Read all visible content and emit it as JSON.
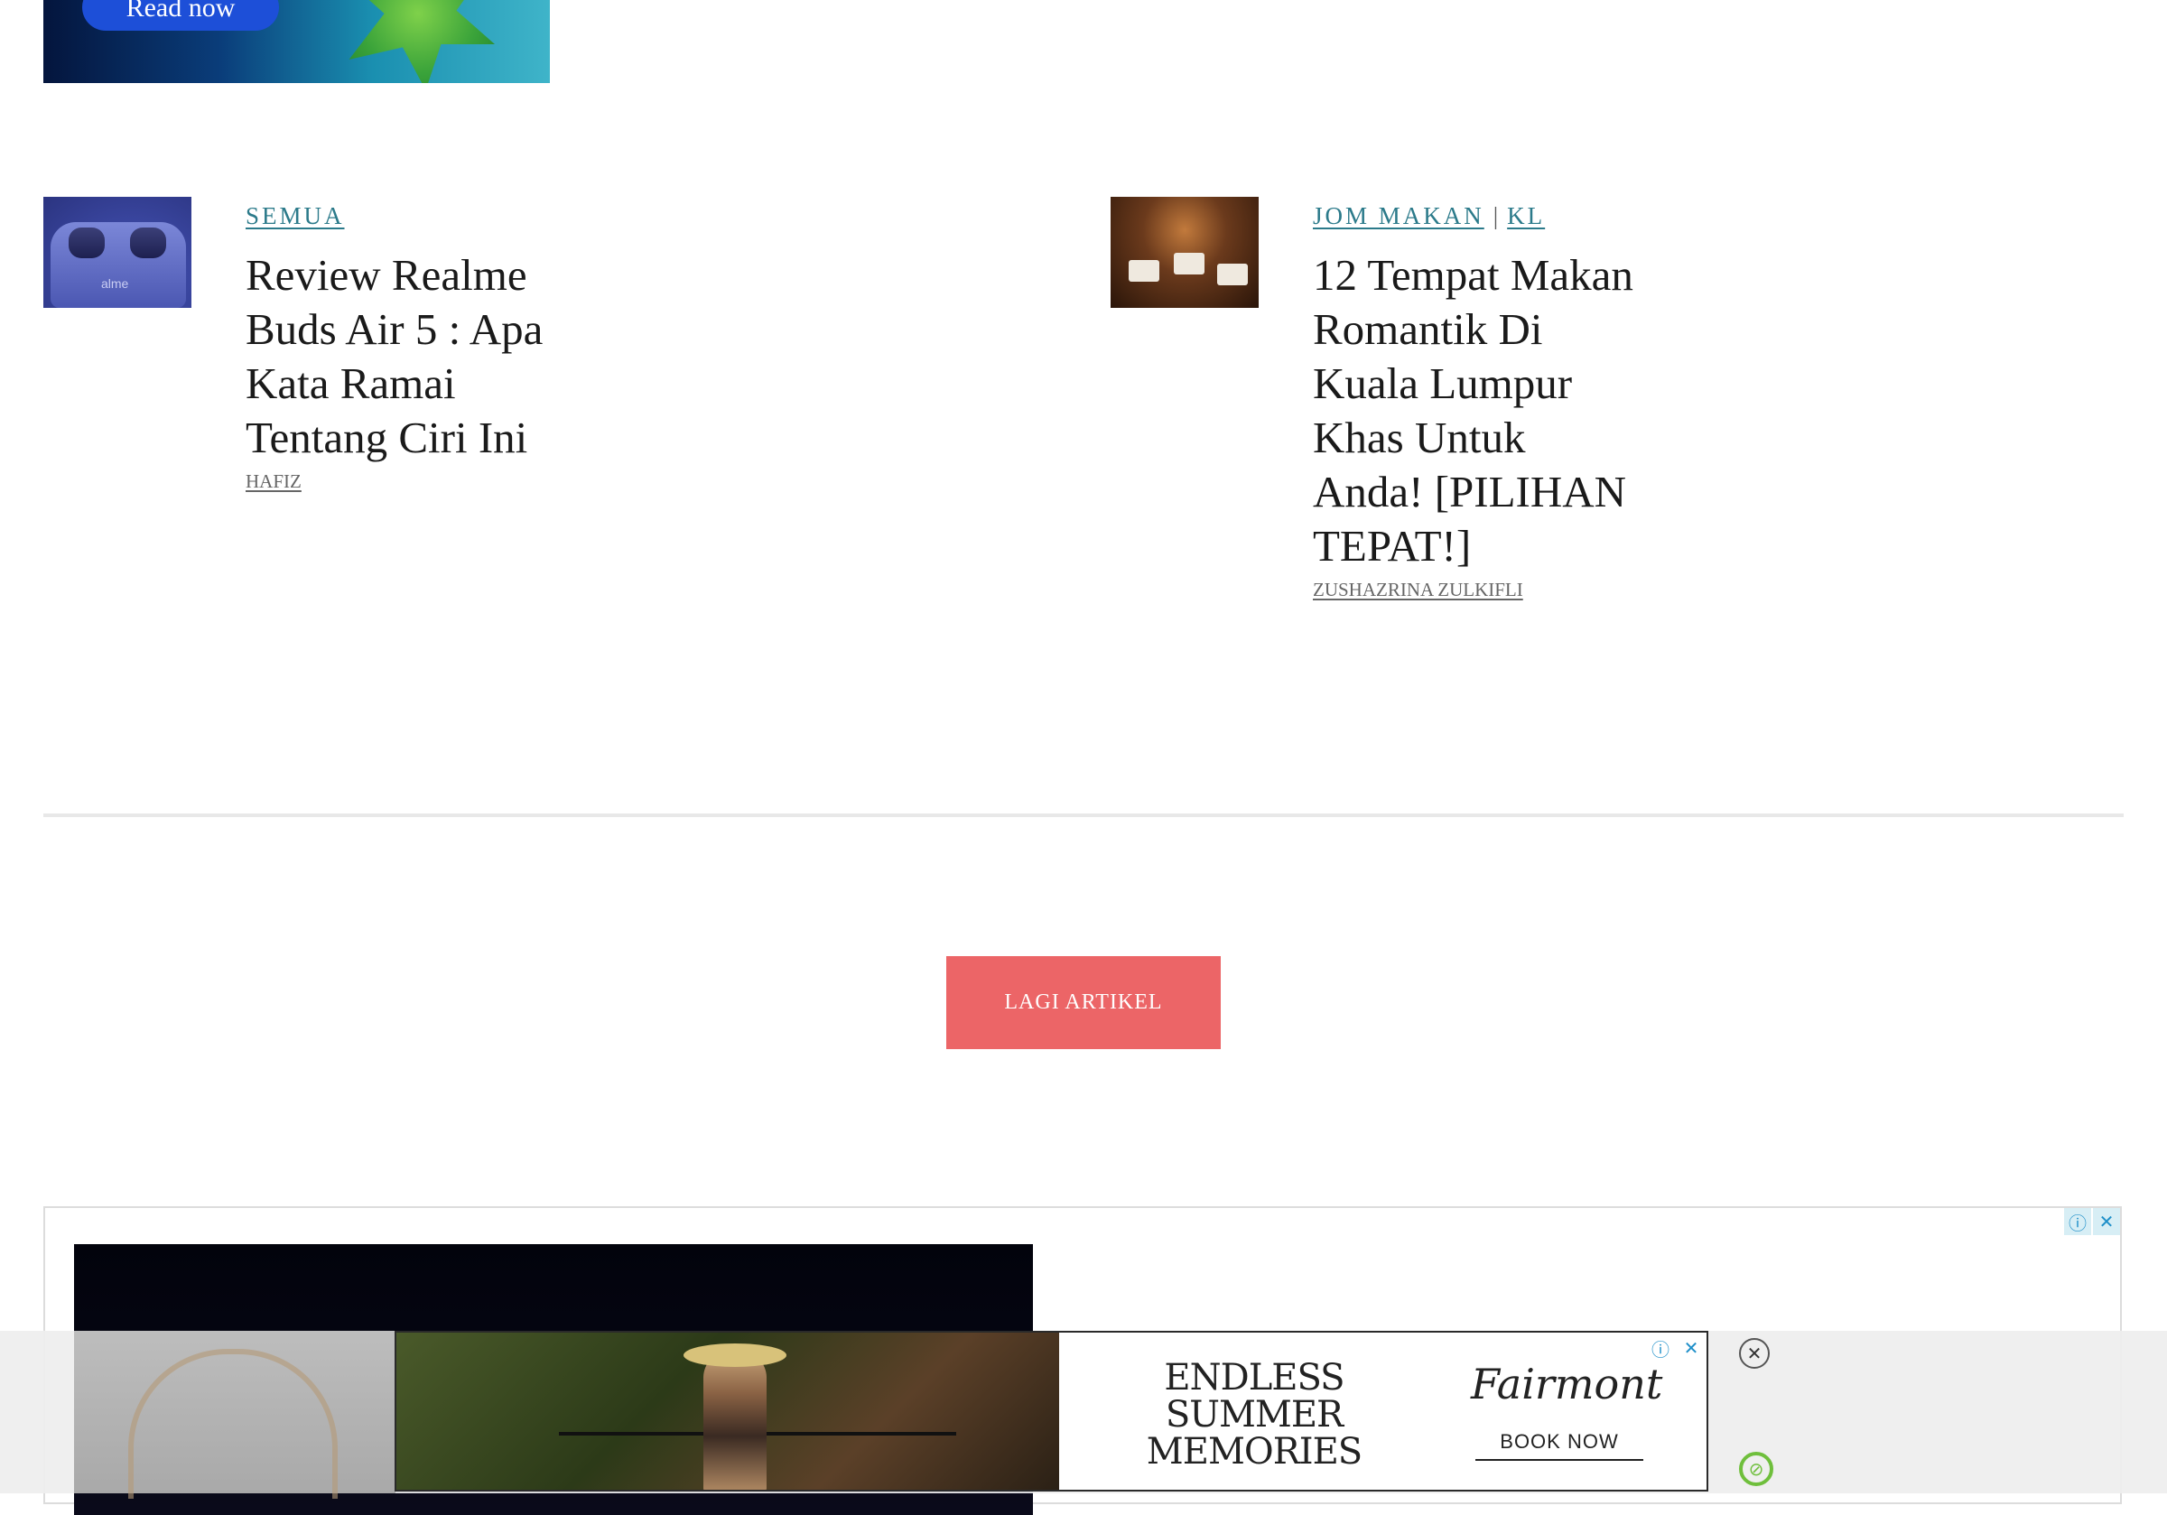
{
  "top_ad": {
    "button_label": "Read now"
  },
  "articles": [
    {
      "categories": [
        "SEMUA"
      ],
      "title": "Review Realme Buds Air 5 : Apa Kata Ramai Tentang Ciri Ini",
      "author": "HAFIZ",
      "thumb_text": "alme"
    },
    {
      "categories": [
        "JOM MAKAN",
        "KL"
      ],
      "category_separator": "|",
      "title": "12 Tempat Makan Romantik Di Kuala Lumpur Khas Untuk Anda! [PILIHAN TEPAT!]",
      "author": "ZUSHAZRINA ZULKIFLI"
    }
  ],
  "load_more": {
    "label": "LAGI ARTIKEL"
  },
  "big_ad": {
    "info_icon": "ⓘ",
    "close_icon": "✕"
  },
  "sticky_ad": {
    "headline": "ENDLESS SUMMER MEMORIES",
    "brand": "Fairmont",
    "cta": "BOOK NOW",
    "info_icon": "ⓘ",
    "close_icon": "✕",
    "adchoices_icon": "▷"
  },
  "sticky_close": "✕",
  "badge_icon": "⊘",
  "colors": {
    "accent_link": "#2b7a8a",
    "button": "#ec6567",
    "divider": "#e8e8e8"
  }
}
